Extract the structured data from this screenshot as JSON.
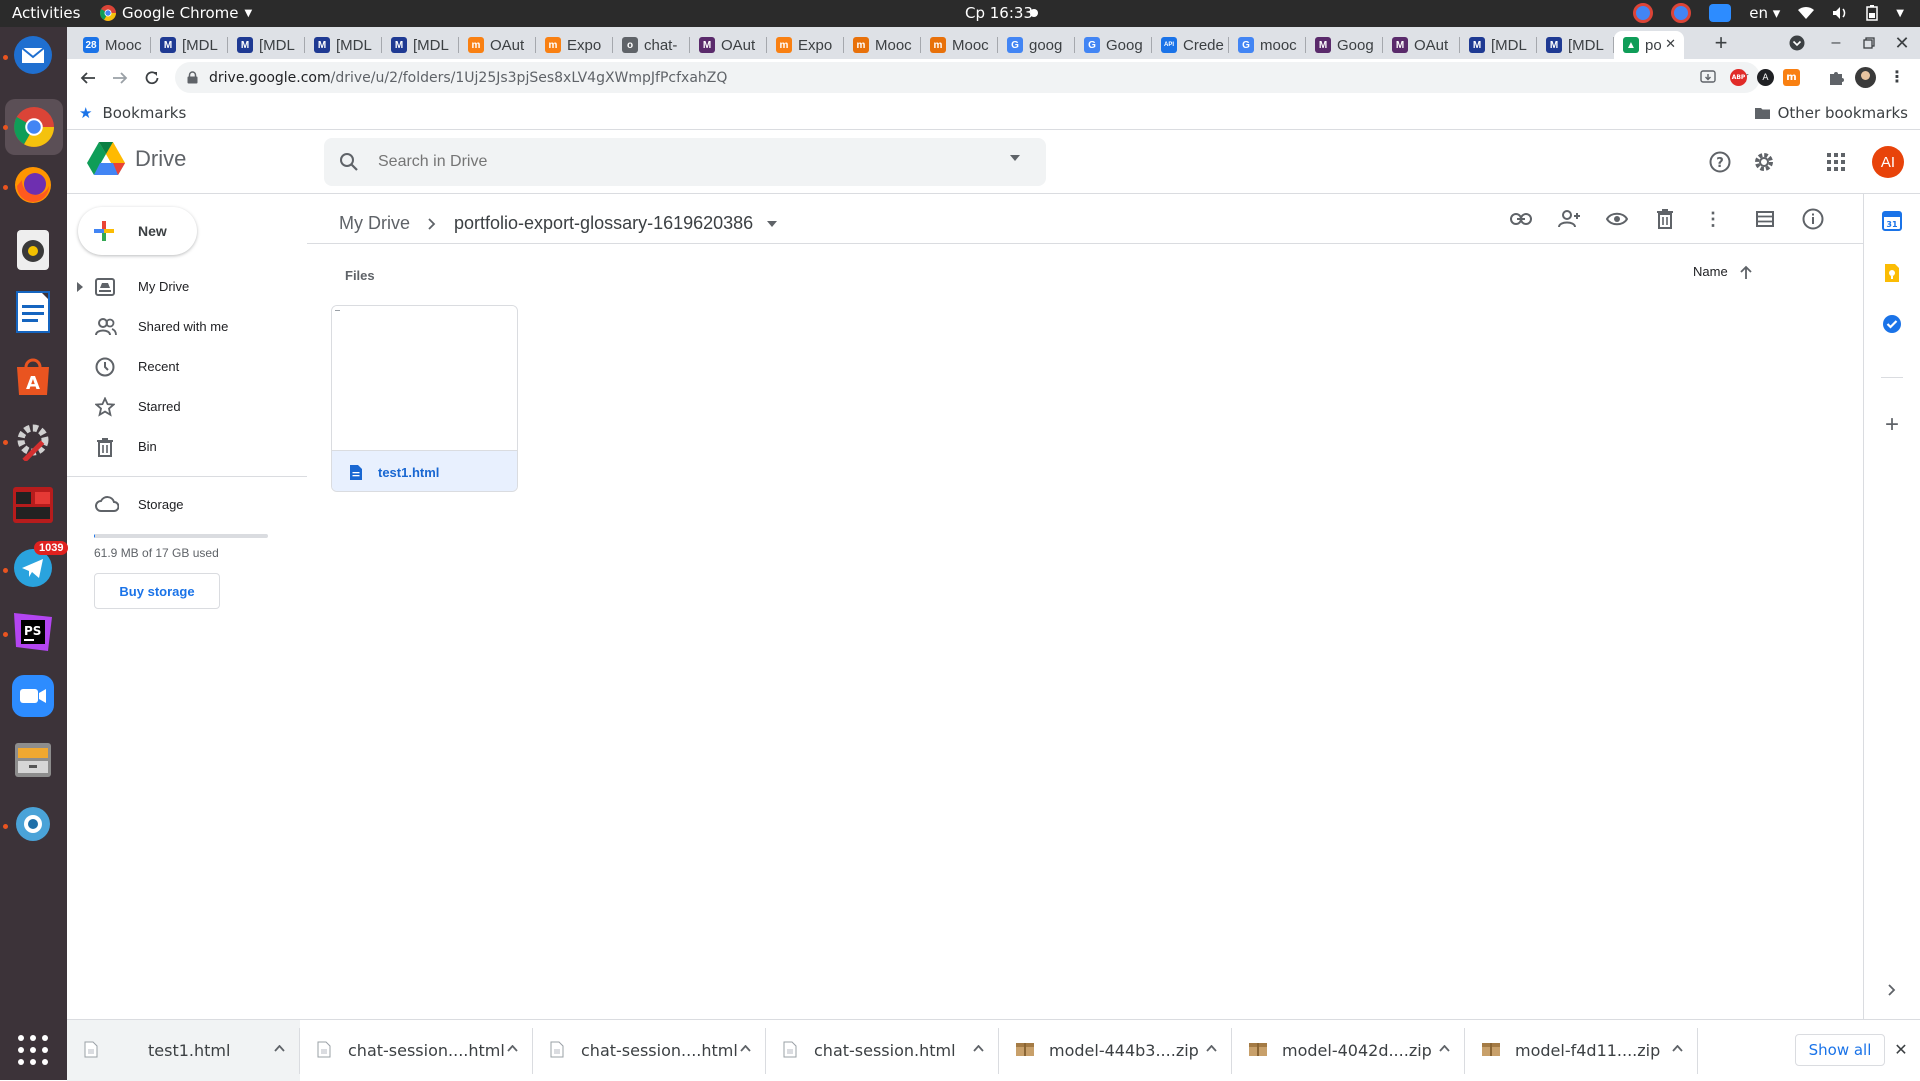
{
  "system": {
    "activities": "Activities",
    "app_name": "Google Chrome",
    "clock": "Ср 16:33",
    "lang": "en"
  },
  "dock": {
    "telegram_badge": "1039"
  },
  "tabs": [
    {
      "label": "Mooc",
      "color": "#1a73e8",
      "glyph": "28"
    },
    {
      "label": "[MDL",
      "color": "#1f3a93",
      "glyph": "M"
    },
    {
      "label": "[MDL",
      "color": "#1f3a93",
      "glyph": "M"
    },
    {
      "label": "[MDL",
      "color": "#1f3a93",
      "glyph": "M"
    },
    {
      "label": "[MDL",
      "color": "#1f3a93",
      "glyph": "M"
    },
    {
      "label": "OAut",
      "color": "#f98012",
      "glyph": "m"
    },
    {
      "label": "Expo",
      "color": "#f98012",
      "glyph": "m"
    },
    {
      "label": "chat-",
      "color": "#5f6368",
      "glyph": "o"
    },
    {
      "label": "OAut",
      "color": "#5a2a6b",
      "glyph": "M"
    },
    {
      "label": "Expo",
      "color": "#f98012",
      "glyph": "m"
    },
    {
      "label": "Mooc",
      "color": "#e8710a",
      "glyph": "m"
    },
    {
      "label": "Mooc",
      "color": "#e8710a",
      "glyph": "m"
    },
    {
      "label": "goog",
      "color": "#4285f4",
      "glyph": "G"
    },
    {
      "label": "Goog",
      "color": "#4285f4",
      "glyph": "G"
    },
    {
      "label": "Crede",
      "color": "#1a73e8",
      "glyph": "API"
    },
    {
      "label": "mooc",
      "color": "#4285f4",
      "glyph": "G"
    },
    {
      "label": "Goog",
      "color": "#5a2a6b",
      "glyph": "M"
    },
    {
      "label": "OAut",
      "color": "#5a2a6b",
      "glyph": "M"
    },
    {
      "label": "[MDL",
      "color": "#1f3a93",
      "glyph": "M"
    },
    {
      "label": "[MDL",
      "color": "#1f3a93",
      "glyph": "M"
    },
    {
      "label": "po",
      "color": "#0f9d58",
      "glyph": "▲",
      "active": true
    }
  ],
  "browser": {
    "url_domain": "drive.google.com",
    "url_path": "/drive/u/2/folders/1Uj25Js3pjSes8xLV4gXWmpJfPcfxahZQ",
    "bookmarks_label": "Bookmarks",
    "other_bookmarks_label": "Other bookmarks"
  },
  "drive": {
    "logo_text": "Drive",
    "search_placeholder": "Search in Drive",
    "avatar_initials": "AI",
    "new_label": "New",
    "nav": {
      "my_drive": "My Drive",
      "shared": "Shared with me",
      "recent": "Recent",
      "starred": "Starred",
      "bin": "Bin",
      "storage": "Storage"
    },
    "storage_used": "61.9 MB of 17 GB used",
    "storage_fraction": 0.0036,
    "buy_storage": "Buy storage",
    "breadcrumb_root": "My Drive",
    "breadcrumb_folder": "portfolio-export-glossary-1619620386",
    "files_heading": "Files",
    "sort_label": "Name",
    "files": [
      {
        "name": "test1.html"
      }
    ]
  },
  "downloads": {
    "items": [
      {
        "name": "test1.html",
        "type": "doc"
      },
      {
        "name": "chat-session....html",
        "type": "doc"
      },
      {
        "name": "chat-session....html",
        "type": "doc"
      },
      {
        "name": "chat-session.html",
        "type": "doc"
      },
      {
        "name": "model-444b3....zip",
        "type": "zip"
      },
      {
        "name": "model-4042d....zip",
        "type": "zip"
      },
      {
        "name": "model-f4d11....zip",
        "type": "zip"
      }
    ],
    "show_all": "Show all"
  }
}
